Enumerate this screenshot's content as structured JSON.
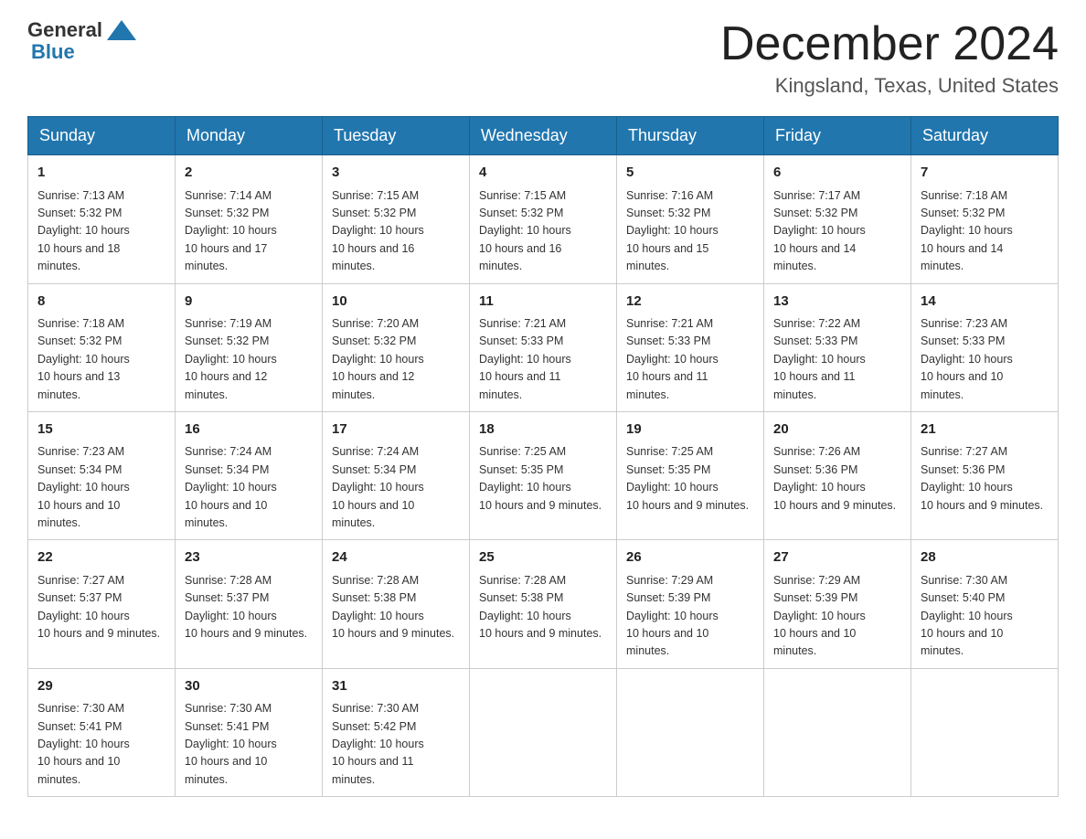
{
  "header": {
    "title": "December 2024",
    "location": "Kingsland, Texas, United States",
    "logo_general": "General",
    "logo_blue": "Blue"
  },
  "weekdays": [
    "Sunday",
    "Monday",
    "Tuesday",
    "Wednesday",
    "Thursday",
    "Friday",
    "Saturday"
  ],
  "weeks": [
    [
      {
        "day": "1",
        "sunrise": "7:13 AM",
        "sunset": "5:32 PM",
        "daylight": "10 hours and 18 minutes."
      },
      {
        "day": "2",
        "sunrise": "7:14 AM",
        "sunset": "5:32 PM",
        "daylight": "10 hours and 17 minutes."
      },
      {
        "day": "3",
        "sunrise": "7:15 AM",
        "sunset": "5:32 PM",
        "daylight": "10 hours and 16 minutes."
      },
      {
        "day": "4",
        "sunrise": "7:15 AM",
        "sunset": "5:32 PM",
        "daylight": "10 hours and 16 minutes."
      },
      {
        "day": "5",
        "sunrise": "7:16 AM",
        "sunset": "5:32 PM",
        "daylight": "10 hours and 15 minutes."
      },
      {
        "day": "6",
        "sunrise": "7:17 AM",
        "sunset": "5:32 PM",
        "daylight": "10 hours and 14 minutes."
      },
      {
        "day": "7",
        "sunrise": "7:18 AM",
        "sunset": "5:32 PM",
        "daylight": "10 hours and 14 minutes."
      }
    ],
    [
      {
        "day": "8",
        "sunrise": "7:18 AM",
        "sunset": "5:32 PM",
        "daylight": "10 hours and 13 minutes."
      },
      {
        "day": "9",
        "sunrise": "7:19 AM",
        "sunset": "5:32 PM",
        "daylight": "10 hours and 12 minutes."
      },
      {
        "day": "10",
        "sunrise": "7:20 AM",
        "sunset": "5:32 PM",
        "daylight": "10 hours and 12 minutes."
      },
      {
        "day": "11",
        "sunrise": "7:21 AM",
        "sunset": "5:33 PM",
        "daylight": "10 hours and 11 minutes."
      },
      {
        "day": "12",
        "sunrise": "7:21 AM",
        "sunset": "5:33 PM",
        "daylight": "10 hours and 11 minutes."
      },
      {
        "day": "13",
        "sunrise": "7:22 AM",
        "sunset": "5:33 PM",
        "daylight": "10 hours and 11 minutes."
      },
      {
        "day": "14",
        "sunrise": "7:23 AM",
        "sunset": "5:33 PM",
        "daylight": "10 hours and 10 minutes."
      }
    ],
    [
      {
        "day": "15",
        "sunrise": "7:23 AM",
        "sunset": "5:34 PM",
        "daylight": "10 hours and 10 minutes."
      },
      {
        "day": "16",
        "sunrise": "7:24 AM",
        "sunset": "5:34 PM",
        "daylight": "10 hours and 10 minutes."
      },
      {
        "day": "17",
        "sunrise": "7:24 AM",
        "sunset": "5:34 PM",
        "daylight": "10 hours and 10 minutes."
      },
      {
        "day": "18",
        "sunrise": "7:25 AM",
        "sunset": "5:35 PM",
        "daylight": "10 hours and 9 minutes."
      },
      {
        "day": "19",
        "sunrise": "7:25 AM",
        "sunset": "5:35 PM",
        "daylight": "10 hours and 9 minutes."
      },
      {
        "day": "20",
        "sunrise": "7:26 AM",
        "sunset": "5:36 PM",
        "daylight": "10 hours and 9 minutes."
      },
      {
        "day": "21",
        "sunrise": "7:27 AM",
        "sunset": "5:36 PM",
        "daylight": "10 hours and 9 minutes."
      }
    ],
    [
      {
        "day": "22",
        "sunrise": "7:27 AM",
        "sunset": "5:37 PM",
        "daylight": "10 hours and 9 minutes."
      },
      {
        "day": "23",
        "sunrise": "7:28 AM",
        "sunset": "5:37 PM",
        "daylight": "10 hours and 9 minutes."
      },
      {
        "day": "24",
        "sunrise": "7:28 AM",
        "sunset": "5:38 PM",
        "daylight": "10 hours and 9 minutes."
      },
      {
        "day": "25",
        "sunrise": "7:28 AM",
        "sunset": "5:38 PM",
        "daylight": "10 hours and 9 minutes."
      },
      {
        "day": "26",
        "sunrise": "7:29 AM",
        "sunset": "5:39 PM",
        "daylight": "10 hours and 10 minutes."
      },
      {
        "day": "27",
        "sunrise": "7:29 AM",
        "sunset": "5:39 PM",
        "daylight": "10 hours and 10 minutes."
      },
      {
        "day": "28",
        "sunrise": "7:30 AM",
        "sunset": "5:40 PM",
        "daylight": "10 hours and 10 minutes."
      }
    ],
    [
      {
        "day": "29",
        "sunrise": "7:30 AM",
        "sunset": "5:41 PM",
        "daylight": "10 hours and 10 minutes."
      },
      {
        "day": "30",
        "sunrise": "7:30 AM",
        "sunset": "5:41 PM",
        "daylight": "10 hours and 10 minutes."
      },
      {
        "day": "31",
        "sunrise": "7:30 AM",
        "sunset": "5:42 PM",
        "daylight": "10 hours and 11 minutes."
      },
      null,
      null,
      null,
      null
    ]
  ],
  "labels": {
    "sunrise": "Sunrise:",
    "sunset": "Sunset:",
    "daylight": "Daylight:"
  }
}
